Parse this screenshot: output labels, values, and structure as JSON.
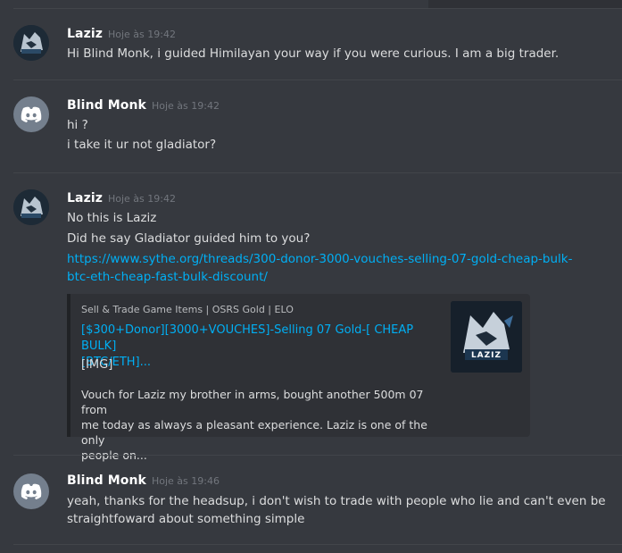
{
  "messages": [
    {
      "username": "Laziz",
      "timestamp": "Hoje às 19:42",
      "avatar_icon": "wolf-logo-avatar",
      "lines": [
        "Hi Blind Monk, i guided Himilayan your way if you were curious. I am a big trader."
      ]
    },
    {
      "username": "Blind Monk",
      "timestamp": "Hoje às 19:42",
      "avatar_icon": "discord-default-avatar",
      "lines": [
        "hi ?",
        "i take it ur not gladiator?"
      ]
    },
    {
      "username": "Laziz",
      "timestamp": "Hoje às 19:42",
      "avatar_icon": "wolf-logo-avatar",
      "lines": [
        "No this is Laziz",
        "Did he say Gladiator guided him to you?"
      ],
      "link_lines": [
        "https://www.sythe.org/threads/300-donor-3000-vouches-selling-07-gold-cheap-bulk-",
        "btc-eth-cheap-fast-bulk-discount/"
      ],
      "embed": {
        "provider": "Sell & Trade Game Items | OSRS Gold | ELO",
        "title_lines": [
          "[$300+Donor][3000+VOUCHES]-Selling 07 Gold-[ CHEAP BULK]",
          "[BTC/ETH]..."
        ],
        "image_text": "[IMG]",
        "description_lines": [
          "Vouch for Laziz my brother in arms, bought another 500m 07 from",
          "me today as always a pleasant experience. Laziz is one of the only",
          "people on..."
        ],
        "thumbnail_text": "LAZIZ",
        "border_color": "#202225"
      }
    },
    {
      "username": "Blind Monk",
      "timestamp": "Hoje às 19:46",
      "avatar_icon": "discord-default-avatar",
      "lines": [
        "yeah, thanks for the headsup, i don't wish to trade with people who lie and can't even be",
        "straightfoward about something simple"
      ]
    }
  ],
  "colors": {
    "background": "#36393f",
    "username": "#ffffff",
    "timestamp": "#72767d",
    "text": "#dcddde",
    "link": "#00aff4",
    "embed_bg": "#2f3136",
    "discord_avatar": "#747f8d"
  }
}
